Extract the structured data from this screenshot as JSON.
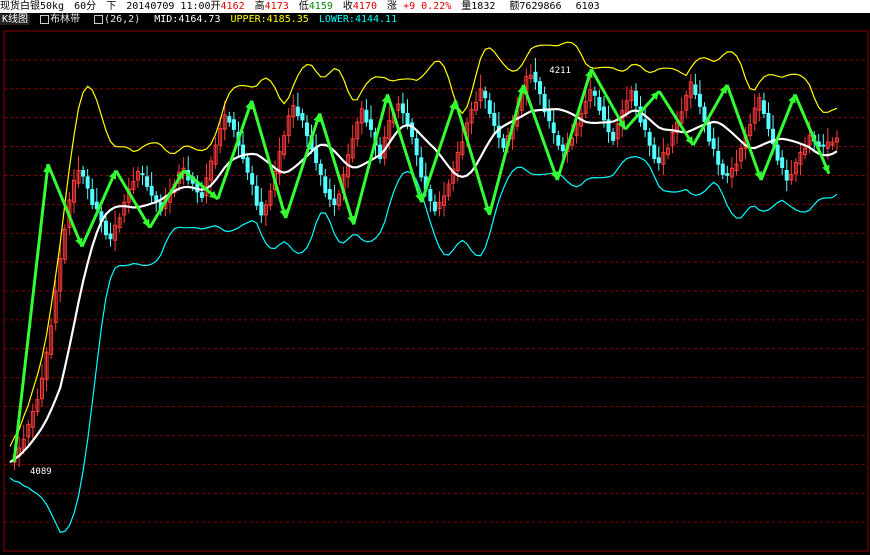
{
  "header": {
    "symbol": "现货白银50kg",
    "period": "60分",
    "nav": "下",
    "datetime": "20140709 11:00",
    "open_label": "开",
    "open": "4162",
    "high_label": "高",
    "high": "4173",
    "low_label": "低",
    "low": "4159",
    "close_label": "收",
    "close": "4170",
    "change_label": "涨",
    "change": "+9",
    "change_pct": "0.22%",
    "volume_label": "量",
    "volume": "1832",
    "amount_label": "额",
    "amount": "7629866",
    "hold": "6103"
  },
  "indicator": {
    "tab1": "K线图",
    "tab2": "布林带",
    "params": "(26,2)",
    "mid_text": "MID:4164.73",
    "upper_text": "UPPER:4185.35",
    "lower_text": "LOWER:4144.11"
  },
  "colors": {
    "background": "#000000",
    "grid": "#8a0000",
    "up_candle": "#ff3c3c",
    "down_candle": "#54ffff",
    "mid": "#ffffff",
    "upper": "#ffff00",
    "lower": "#00ffff",
    "zigzag": "#33ff33"
  },
  "chart_data": {
    "type": "line",
    "y_range": [
      4058,
      4222
    ],
    "grid": true,
    "annotations": [
      {
        "text": "4211",
        "near": "high"
      },
      {
        "text": "4089",
        "near": "low"
      }
    ],
    "zigzag_values": [
      4086,
      4180,
      4154,
      4178,
      4160,
      4178,
      4169,
      4200,
      4163,
      4196,
      4161,
      4202,
      4168,
      4200,
      4164,
      4205,
      4175,
      4210,
      4191,
      4203,
      4186,
      4205,
      4175,
      4202,
      4177
    ],
    "close_series": [
      4086,
      4088,
      4090,
      4094,
      4097,
      4102,
      4106,
      4112,
      4120,
      4130,
      4140,
      4150,
      4160,
      4168,
      4174,
      4178,
      4176,
      4172,
      4168,
      4165,
      4162,
      4158,
      4156,
      4160,
      4164,
      4168,
      4172,
      4175,
      4177,
      4176,
      4173,
      4170,
      4168,
      4166,
      4168,
      4171,
      4174,
      4177,
      4178,
      4176,
      4174,
      4171,
      4170,
      4175,
      4180,
      4186,
      4191,
      4195,
      4194,
      4190,
      4186,
      4182,
      4177,
      4173,
      4168,
      4164,
      4167,
      4172,
      4177,
      4183,
      4189,
      4195,
      4198,
      4196,
      4193,
      4189,
      4185,
      4180,
      4176,
      4172,
      4169,
      4167,
      4171,
      4176,
      4182,
      4188,
      4193,
      4197,
      4194,
      4190,
      4186,
      4182,
      4188,
      4193,
      4197,
      4199,
      4196,
      4193,
      4188,
      4182,
      4176,
      4172,
      4168,
      4166,
      4167,
      4170,
      4174,
      4178,
      4183,
      4188,
      4193,
      4197,
      4200,
      4203,
      4200,
      4196,
      4192,
      4188,
      4186,
      4188,
      4192,
      4197,
      4202,
      4207,
      4209,
      4206,
      4202,
      4197,
      4193,
      4189,
      4186,
      4184,
      4186,
      4189,
      4192,
      4196,
      4200,
      4203,
      4201,
      4198,
      4194,
      4190,
      4188,
      4192,
      4196,
      4200,
      4203,
      4198,
      4194,
      4190,
      4186,
      4182,
      4180,
      4183,
      4186,
      4190,
      4193,
      4197,
      4201,
      4205,
      4202,
      4198,
      4193,
      4188,
      4184,
      4180,
      4177,
      4176,
      4178,
      4181,
      4185,
      4189,
      4193,
      4197,
      4200,
      4196,
      4191,
      4186,
      4182,
      4178,
      4175,
      4177,
      4180,
      4183,
      4186,
      4189,
      4187,
      4186,
      4185,
      4186,
      4187,
      4188
    ]
  }
}
